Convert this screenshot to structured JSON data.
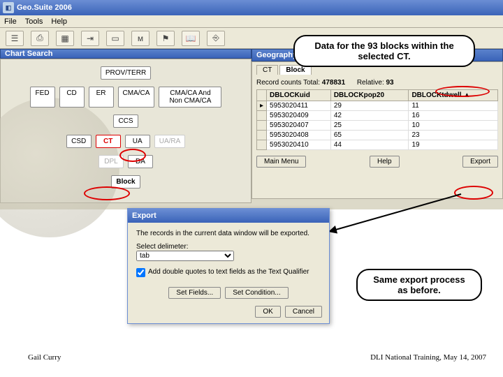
{
  "app": {
    "title": "Geo.Suite 2006"
  },
  "menu": {
    "file": "File",
    "tools": "Tools",
    "help": "Help"
  },
  "panes": {
    "chart_title": "Chart Search",
    "geo_title": "Geography Data"
  },
  "chart_nodes": {
    "prov": "PROV/TERR",
    "fed": "FED",
    "cd": "CD",
    "er": "ER",
    "cmaca": "CMA/CA",
    "cmaca_non": "CMA/CA And Non CMA/CA",
    "ccs": "CCS",
    "csd": "CSD",
    "ct": "CT",
    "ua": "UA",
    "uara": "UA/RA",
    "dpl": "DPL",
    "da": "DA",
    "block": "Block"
  },
  "geo": {
    "tab_ct": "CT",
    "tab_block": "Block",
    "counts_label": "Record counts Total:",
    "counts_total": "478831",
    "rel_label": "Relative:",
    "rel_value": "93",
    "cols": {
      "uid": "DBLOCKuid",
      "pop": "DBLOCKpop20",
      "dwell": "DBLOCKtdwell"
    },
    "rows": [
      {
        "uid": "5953020411",
        "pop": "29",
        "dwell": "11"
      },
      {
        "uid": "5953020409",
        "pop": "42",
        "dwell": "16"
      },
      {
        "uid": "5953020407",
        "pop": "25",
        "dwell": "10"
      },
      {
        "uid": "5953020408",
        "pop": "65",
        "dwell": "23"
      },
      {
        "uid": "5953020410",
        "pop": "44",
        "dwell": "19"
      }
    ],
    "btn_main": "Main Menu",
    "btn_help": "Help",
    "btn_export": "Export"
  },
  "export": {
    "title": "Export",
    "msg": "The records in the current data window will be exported.",
    "delim_label": "Select delimeter:",
    "delim_value": "tab",
    "chk_label": "Add double quotes to text fields as the Text Qualifier",
    "btn_fields": "Set Fields...",
    "btn_cond": "Set Condition...",
    "btn_ok": "OK",
    "btn_cancel": "Cancel"
  },
  "callouts": {
    "top": "Data for the 93 blocks within the selected CT.",
    "bottom": "Same export process as before."
  },
  "footer": {
    "left": "Gail Curry",
    "right": "DLI National Training, May 14, 2007"
  }
}
